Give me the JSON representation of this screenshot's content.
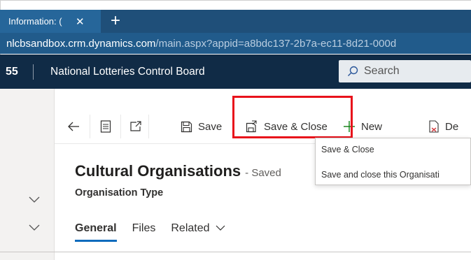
{
  "browser": {
    "tab_title": "Information: (",
    "tab_close": "✕",
    "new_tab": "+",
    "url_host": "nlcbsandbox.crm.dynamics.com",
    "url_path": "/main.aspx?appid=a8bdc137-2b7a-ec11-8d21-000d"
  },
  "app_header": {
    "brand_fragment": "55",
    "app_name": "National Lotteries Control Board",
    "search_placeholder": "Search"
  },
  "command_bar": {
    "back_icon": "back-arrow-icon",
    "save_label": "Save",
    "save_close_label": "Save & Close",
    "new_label": "New",
    "delete_label": "De"
  },
  "tooltip": {
    "title": "Save & Close",
    "description": "Save and close this Organisati"
  },
  "form": {
    "title": "Cultural Organisations",
    "status": "- Saved",
    "subtitle": "Organisation Type",
    "tabs": [
      "General",
      "Files",
      "Related"
    ]
  },
  "colors": {
    "tab_strip": "#1f4f79",
    "address_bar": "#215b8b",
    "app_header": "#102b46",
    "highlight": "#e8121b",
    "accent": "#0f6cbd",
    "new_plus": "#107c10"
  }
}
